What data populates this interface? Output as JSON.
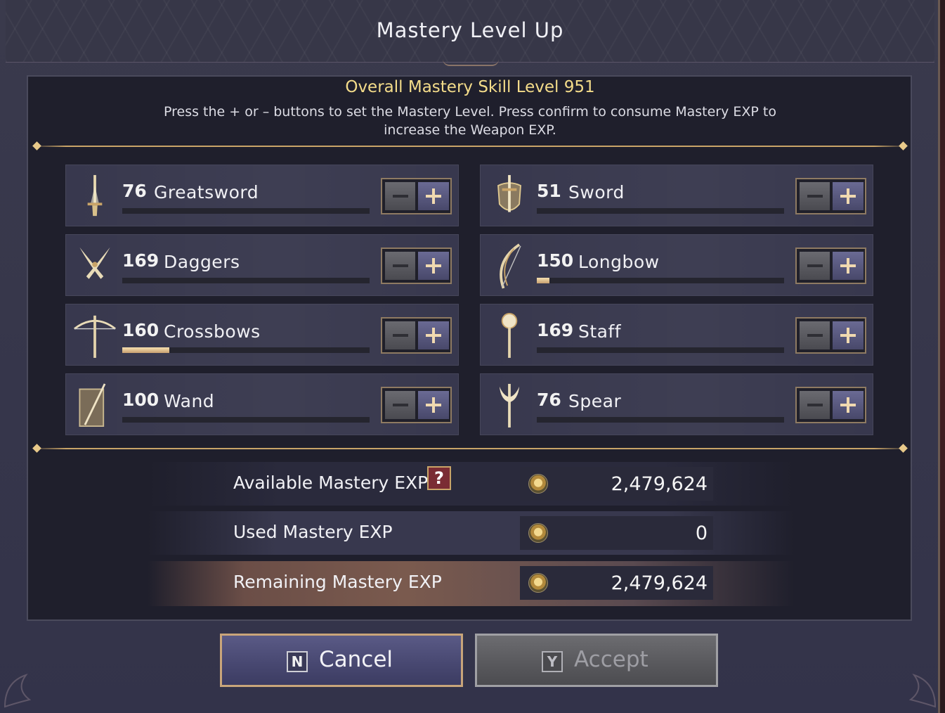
{
  "window": {
    "title": "Mastery Level Up"
  },
  "intro": {
    "title": "Overall Mastery Skill Level 951",
    "line1": "Press the + or – buttons to set the Mastery Level. Press confirm to consume Mastery EXP to",
    "line2": "increase the Weapon EXP."
  },
  "weapons": [
    {
      "level": "76",
      "name": "Greatsword",
      "icon": "greatsword-icon",
      "progress": 0.0
    },
    {
      "level": "51",
      "name": "Sword",
      "icon": "sword-shield-icon",
      "progress": 0.0
    },
    {
      "level": "169",
      "name": "Daggers",
      "icon": "daggers-icon",
      "progress": 0.0
    },
    {
      "level": "150",
      "name": "Longbow",
      "icon": "longbow-icon",
      "progress": 0.05
    },
    {
      "level": "160",
      "name": "Crossbows",
      "icon": "crossbow-icon",
      "progress": 0.19
    },
    {
      "level": "169",
      "name": "Staff",
      "icon": "staff-icon",
      "progress": 0.0
    },
    {
      "level": "100",
      "name": "Wand",
      "icon": "wand-icon",
      "progress": 0.0
    },
    {
      "level": "76",
      "name": "Spear",
      "icon": "spear-icon",
      "progress": 0.0
    }
  ],
  "exp": {
    "available_label": "Available Mastery EXP",
    "available_value": "2,479,624",
    "help_label": "?",
    "used_label": "Used Mastery EXP",
    "used_value": "0",
    "remaining_label": "Remaining Mastery EXP",
    "remaining_value": "2,479,624"
  },
  "buttons": {
    "cancel_key": "N",
    "cancel_label": "Cancel",
    "accept_key": "Y",
    "accept_label": "Accept"
  },
  "colors": {
    "accent_gold": "#c9a468",
    "title_yellow": "#f4dc8a",
    "help_red": "#7a2c34"
  }
}
